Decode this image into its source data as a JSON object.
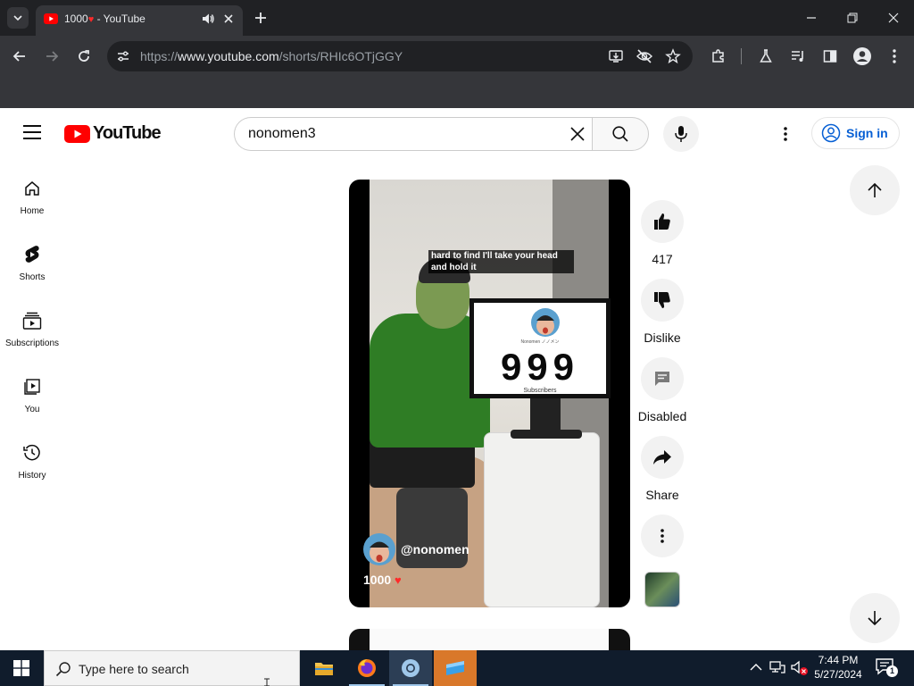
{
  "browser": {
    "tab": {
      "title": "1000",
      "title_heart": "♥",
      "title_suffix": " - YouTube"
    },
    "url": {
      "prefix": "https://",
      "host": "www.youtube.com",
      "path": "/shorts/RHIc6OTjGGY"
    }
  },
  "youtube": {
    "logo_text": "YouTube",
    "search": {
      "value": "nonomen3",
      "placeholder": "Search"
    },
    "sign_in_label": "Sign in",
    "nav": [
      {
        "label": "Home"
      },
      {
        "label": "Shorts"
      },
      {
        "label": "Subscriptions"
      },
      {
        "label": "You"
      },
      {
        "label": "History"
      }
    ],
    "short": {
      "caption": "hard to find I'll take your head and hold it",
      "monitor_name": "Nonomen ノノメン",
      "monitor_count": "999",
      "monitor_subs": "Subscribers",
      "channel_handle": "@nonomen",
      "title": "1000",
      "title_heart": "♥"
    },
    "actions": {
      "likes": "417",
      "dislike_label": "Dislike",
      "comments_label": "Disabled",
      "share_label": "Share"
    }
  },
  "taskbar": {
    "search_placeholder": "Type here to search",
    "time": "7:44 PM",
    "date": "5/27/2024",
    "notifications": "1"
  },
  "colors": {
    "yt_red": "#ff0000",
    "signin_blue": "#065fd4",
    "taskbar": "#101c2c"
  }
}
